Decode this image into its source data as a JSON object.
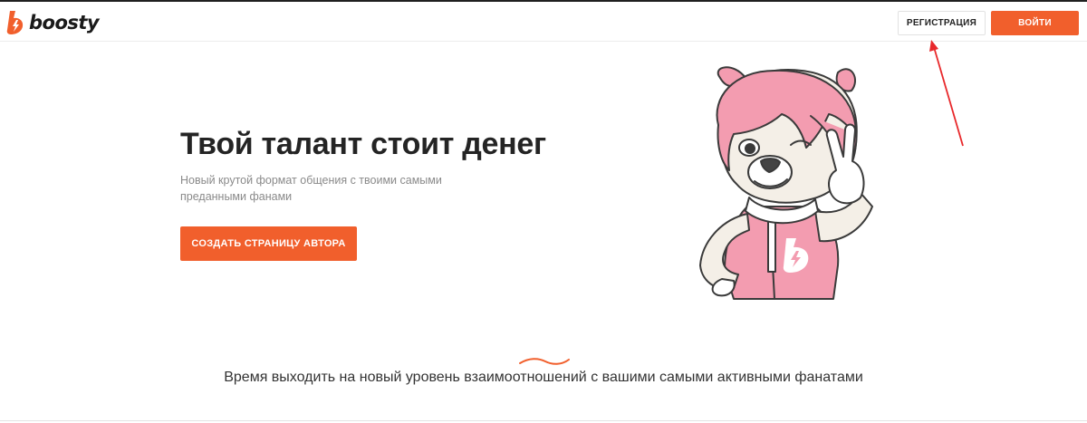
{
  "header": {
    "logo_text": "boosty",
    "register_label": "РЕГИСТРАЦИЯ",
    "login_label": "ВОЙТИ"
  },
  "hero": {
    "title": "Твой талант стоит денег",
    "subtitle": "Новый крутой формат общения с твоими самыми преданными фанами",
    "cta_label": "СОЗДАТЬ СТРАНИЦУ АВТОРА"
  },
  "tagline": "Время выходить на новый уровень взаимоотношений с вашими самыми активными фанатами",
  "colors": {
    "accent": "#f15f2c",
    "annotation_arrow": "#e8282b",
    "mascot_hair": "#f39cb0",
    "mascot_fur": "#f4efe7"
  },
  "icons": {
    "logo_mark": "boosty-bolt-logo",
    "mascot": "bear-mascot-illustration"
  }
}
